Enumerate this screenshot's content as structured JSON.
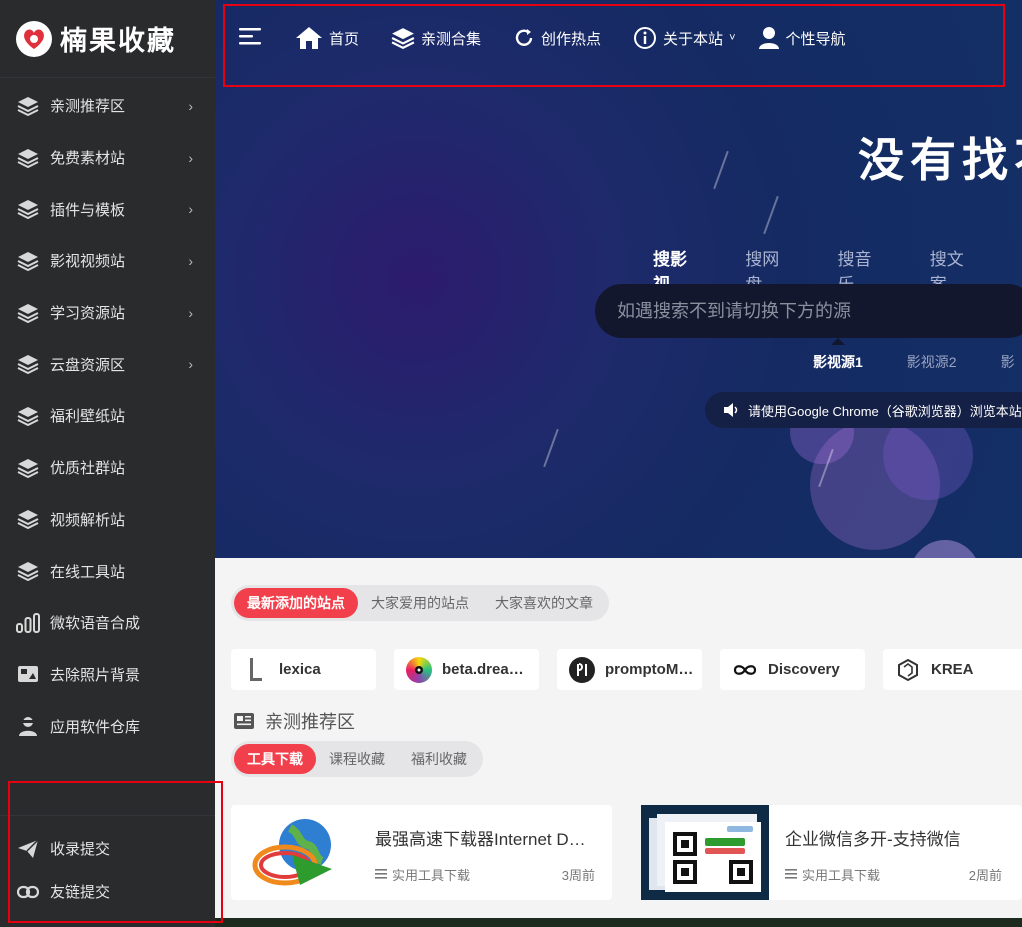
{
  "brand": {
    "name": "楠果收藏"
  },
  "sidebar": {
    "items": [
      {
        "label": "亲测推荐区",
        "icon": "layers-icon",
        "has_submenu": true
      },
      {
        "label": "免费素材站",
        "icon": "layers-icon",
        "has_submenu": true
      },
      {
        "label": "插件与模板",
        "icon": "layers-icon",
        "has_submenu": true
      },
      {
        "label": "影视视频站",
        "icon": "layers-icon",
        "has_submenu": true
      },
      {
        "label": "学习资源站",
        "icon": "layers-icon",
        "has_submenu": true
      },
      {
        "label": "云盘资源区",
        "icon": "layers-icon",
        "has_submenu": true
      },
      {
        "label": "福利壁纸站",
        "icon": "layers-icon",
        "has_submenu": false
      },
      {
        "label": "优质社群站",
        "icon": "layers-icon",
        "has_submenu": false
      },
      {
        "label": "视频解析站",
        "icon": "layers-icon",
        "has_submenu": false
      },
      {
        "label": "在线工具站",
        "icon": "layers-icon",
        "has_submenu": false
      },
      {
        "label": "微软语音合成",
        "icon": "audio-bars-icon",
        "has_submenu": false
      },
      {
        "label": "去除照片背景",
        "icon": "photo-icon",
        "has_submenu": false
      },
      {
        "label": "应用软件仓库",
        "icon": "hacker-icon",
        "has_submenu": false
      }
    ],
    "bottom": [
      {
        "label": "收录提交",
        "icon": "paper-plane-icon"
      },
      {
        "label": "友链提交",
        "icon": "link-icon"
      }
    ]
  },
  "topnav": {
    "items": [
      {
        "label": "首页",
        "icon": "home-icon"
      },
      {
        "label": "亲测合集",
        "icon": "layers-icon"
      },
      {
        "label": "创作热点",
        "icon": "refresh-icon"
      },
      {
        "label": "关于本站",
        "icon": "info-icon",
        "dropdown": true
      },
      {
        "label": "个性导航",
        "icon": "user-icon"
      }
    ]
  },
  "hero": {
    "title": "没有找不",
    "search_tabs": [
      "搜影视",
      "搜网盘",
      "搜音乐",
      "搜文案"
    ],
    "active_search_tab": 0,
    "search_placeholder": "如遇搜索不到请切换下方的源",
    "source_tabs": [
      "影视源1",
      "影视源2",
      "影"
    ],
    "active_source_tab": 0,
    "notice": "请使用Google Chrome（谷歌浏览器）浏览本站"
  },
  "content": {
    "feed_tabs": [
      "最新添加的站点",
      "大家爱用的站点",
      "大家喜欢的文章"
    ],
    "active_feed_tab": 0,
    "sites": [
      {
        "name": "lexica",
        "icon": "lexica-logo-icon"
      },
      {
        "name": "beta.dreamstudio",
        "icon": "dreamstudio-logo-icon"
      },
      {
        "name": "promptoMANIA",
        "icon": "promptomania-logo-icon"
      },
      {
        "name": "Discovery",
        "icon": "infinity-icon"
      },
      {
        "name": "KREA",
        "icon": "krea-logo-icon"
      }
    ],
    "section_title": "亲测推荐区",
    "section_tabs": [
      "工具下载",
      "课程收藏",
      "福利收藏"
    ],
    "active_section_tab": 0,
    "posts": [
      {
        "title": "最强高速下载器Internet Download Manager",
        "category": "实用工具下载",
        "time": "3周前",
        "thumb": "globe-download-icon"
      },
      {
        "title": "企业微信多开-支持微信",
        "category": "实用工具下载",
        "time": "2周前",
        "thumb": "qr-screenshot-thumb"
      }
    ]
  },
  "colors": {
    "accent": "#f1404b",
    "sidebar_bg": "#2a2b2d",
    "hero_bg": "#1e2a6b",
    "annotation": "#e60012"
  }
}
